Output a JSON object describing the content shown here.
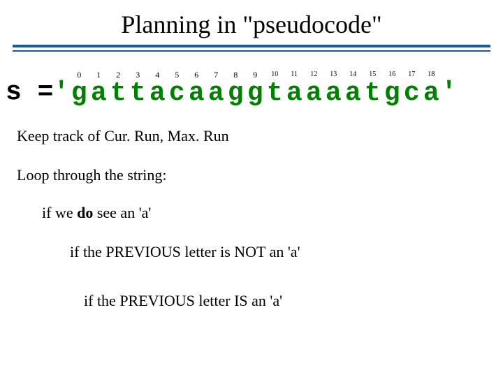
{
  "title": "Planning in \"pseudocode\"",
  "code": {
    "lhs": "s = ",
    "open_quote": "'",
    "close_quote": "'",
    "chars": [
      {
        "idx": "0",
        "idx_small": false,
        "ch": "g"
      },
      {
        "idx": "1",
        "idx_small": false,
        "ch": "a"
      },
      {
        "idx": "2",
        "idx_small": false,
        "ch": "t"
      },
      {
        "idx": "3",
        "idx_small": false,
        "ch": "t"
      },
      {
        "idx": "4",
        "idx_small": false,
        "ch": "a"
      },
      {
        "idx": "5",
        "idx_small": false,
        "ch": "c"
      },
      {
        "idx": "6",
        "idx_small": false,
        "ch": "a"
      },
      {
        "idx": "7",
        "idx_small": false,
        "ch": "a"
      },
      {
        "idx": "8",
        "idx_small": false,
        "ch": "g"
      },
      {
        "idx": "9",
        "idx_small": false,
        "ch": "g"
      },
      {
        "idx": "10",
        "idx_small": true,
        "ch": "t"
      },
      {
        "idx": "11",
        "idx_small": true,
        "ch": "a"
      },
      {
        "idx": "12",
        "idx_small": true,
        "ch": "a"
      },
      {
        "idx": "13",
        "idx_small": true,
        "ch": "a"
      },
      {
        "idx": "14",
        "idx_small": true,
        "ch": "a"
      },
      {
        "idx": "15",
        "idx_small": true,
        "ch": "t"
      },
      {
        "idx": "16",
        "idx_small": true,
        "ch": "g"
      },
      {
        "idx": "17",
        "idx_small": true,
        "ch": "c"
      },
      {
        "idx": "18",
        "idx_small": true,
        "ch": "a"
      }
    ]
  },
  "lines": {
    "l1": "Keep track of Cur. Run, Max. Run",
    "l2": "Loop through the string:",
    "l3a": "if we ",
    "l3b": "do",
    "l3c": " see an 'a'",
    "l4": "if the PREVIOUS letter is NOT an 'a'",
    "l5": "if the PREVIOUS letter IS an 'a'"
  }
}
